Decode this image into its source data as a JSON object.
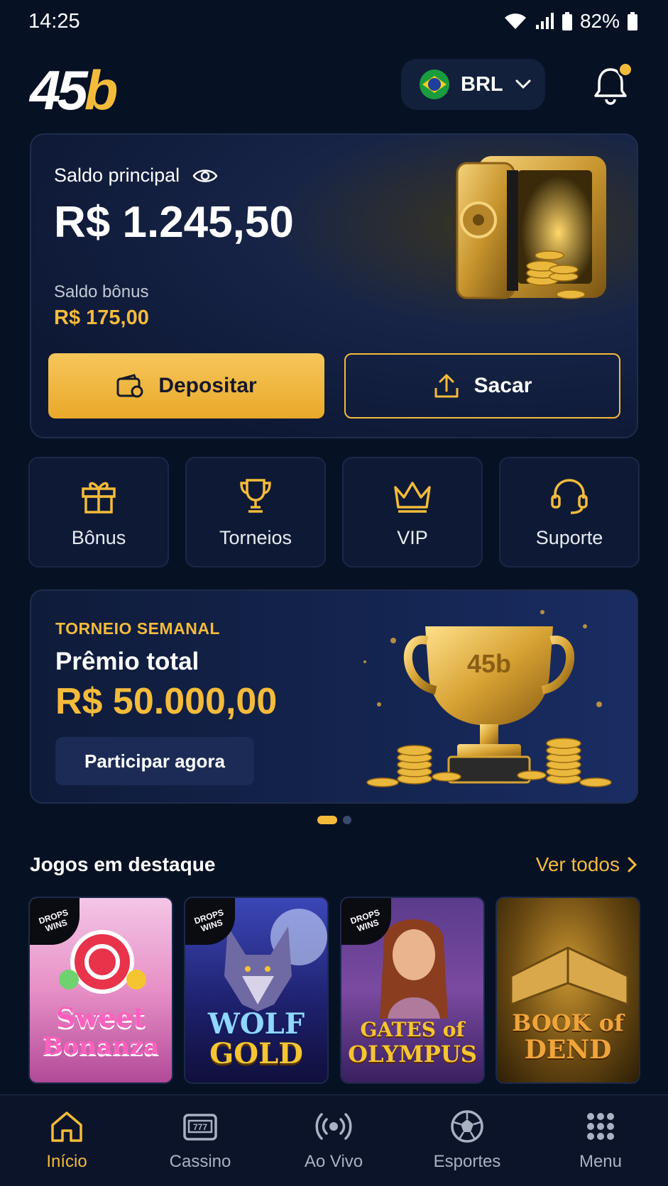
{
  "status_bar": {
    "time": "14:25",
    "battery": "82%"
  },
  "header": {
    "logo_part1": "45",
    "logo_part2": "b",
    "currency": "BRL"
  },
  "balance": {
    "label": "Saldo principal",
    "amount": "R$ 1.245,50",
    "bonus_label": "Saldo bônus",
    "bonus_amount": "R$ 175,00",
    "deposit_label": "Depositar",
    "withdraw_label": "Sacar"
  },
  "quick_links": [
    {
      "label": "Bônus",
      "icon": "gift-icon"
    },
    {
      "label": "Torneios",
      "icon": "trophy-icon"
    },
    {
      "label": "VIP",
      "icon": "crown-icon"
    },
    {
      "label": "Suporte",
      "icon": "headset-icon"
    }
  ],
  "tournament": {
    "kicker": "TORNEIO SEMANAL",
    "title": "Prêmio total",
    "prize": "R$ 50.000,00",
    "cta": "Participar agora",
    "trophy_text": "45b"
  },
  "carousel": {
    "slides": 2,
    "active": 0
  },
  "featured": {
    "title": "Jogos em destaque",
    "see_all": "Ver todos",
    "games": [
      {
        "line1": "Sweet",
        "line2": "Bonanza",
        "badge": "DROPS WINS"
      },
      {
        "line1": "WOLF",
        "line2": "GOLD",
        "badge": "DROPS WINS"
      },
      {
        "line1": "GATES of",
        "line2": "OLYMPUS",
        "badge": "DROPS WINS"
      },
      {
        "line1": "BOOK of",
        "line2": "DEND",
        "badge": ""
      }
    ]
  },
  "bottom_nav": [
    {
      "label": "Início",
      "icon": "home-icon",
      "active": true
    },
    {
      "label": "Cassino",
      "icon": "slot-machine-icon",
      "active": false
    },
    {
      "label": "Ao Vivo",
      "icon": "live-icon",
      "active": false
    },
    {
      "label": "Esportes",
      "icon": "soccer-ball-icon",
      "active": false
    },
    {
      "label": "Menu",
      "icon": "grid-icon",
      "active": false
    }
  ],
  "colors": {
    "accent": "#f4bb3b",
    "background": "#071124",
    "card": "#0e1a35"
  }
}
